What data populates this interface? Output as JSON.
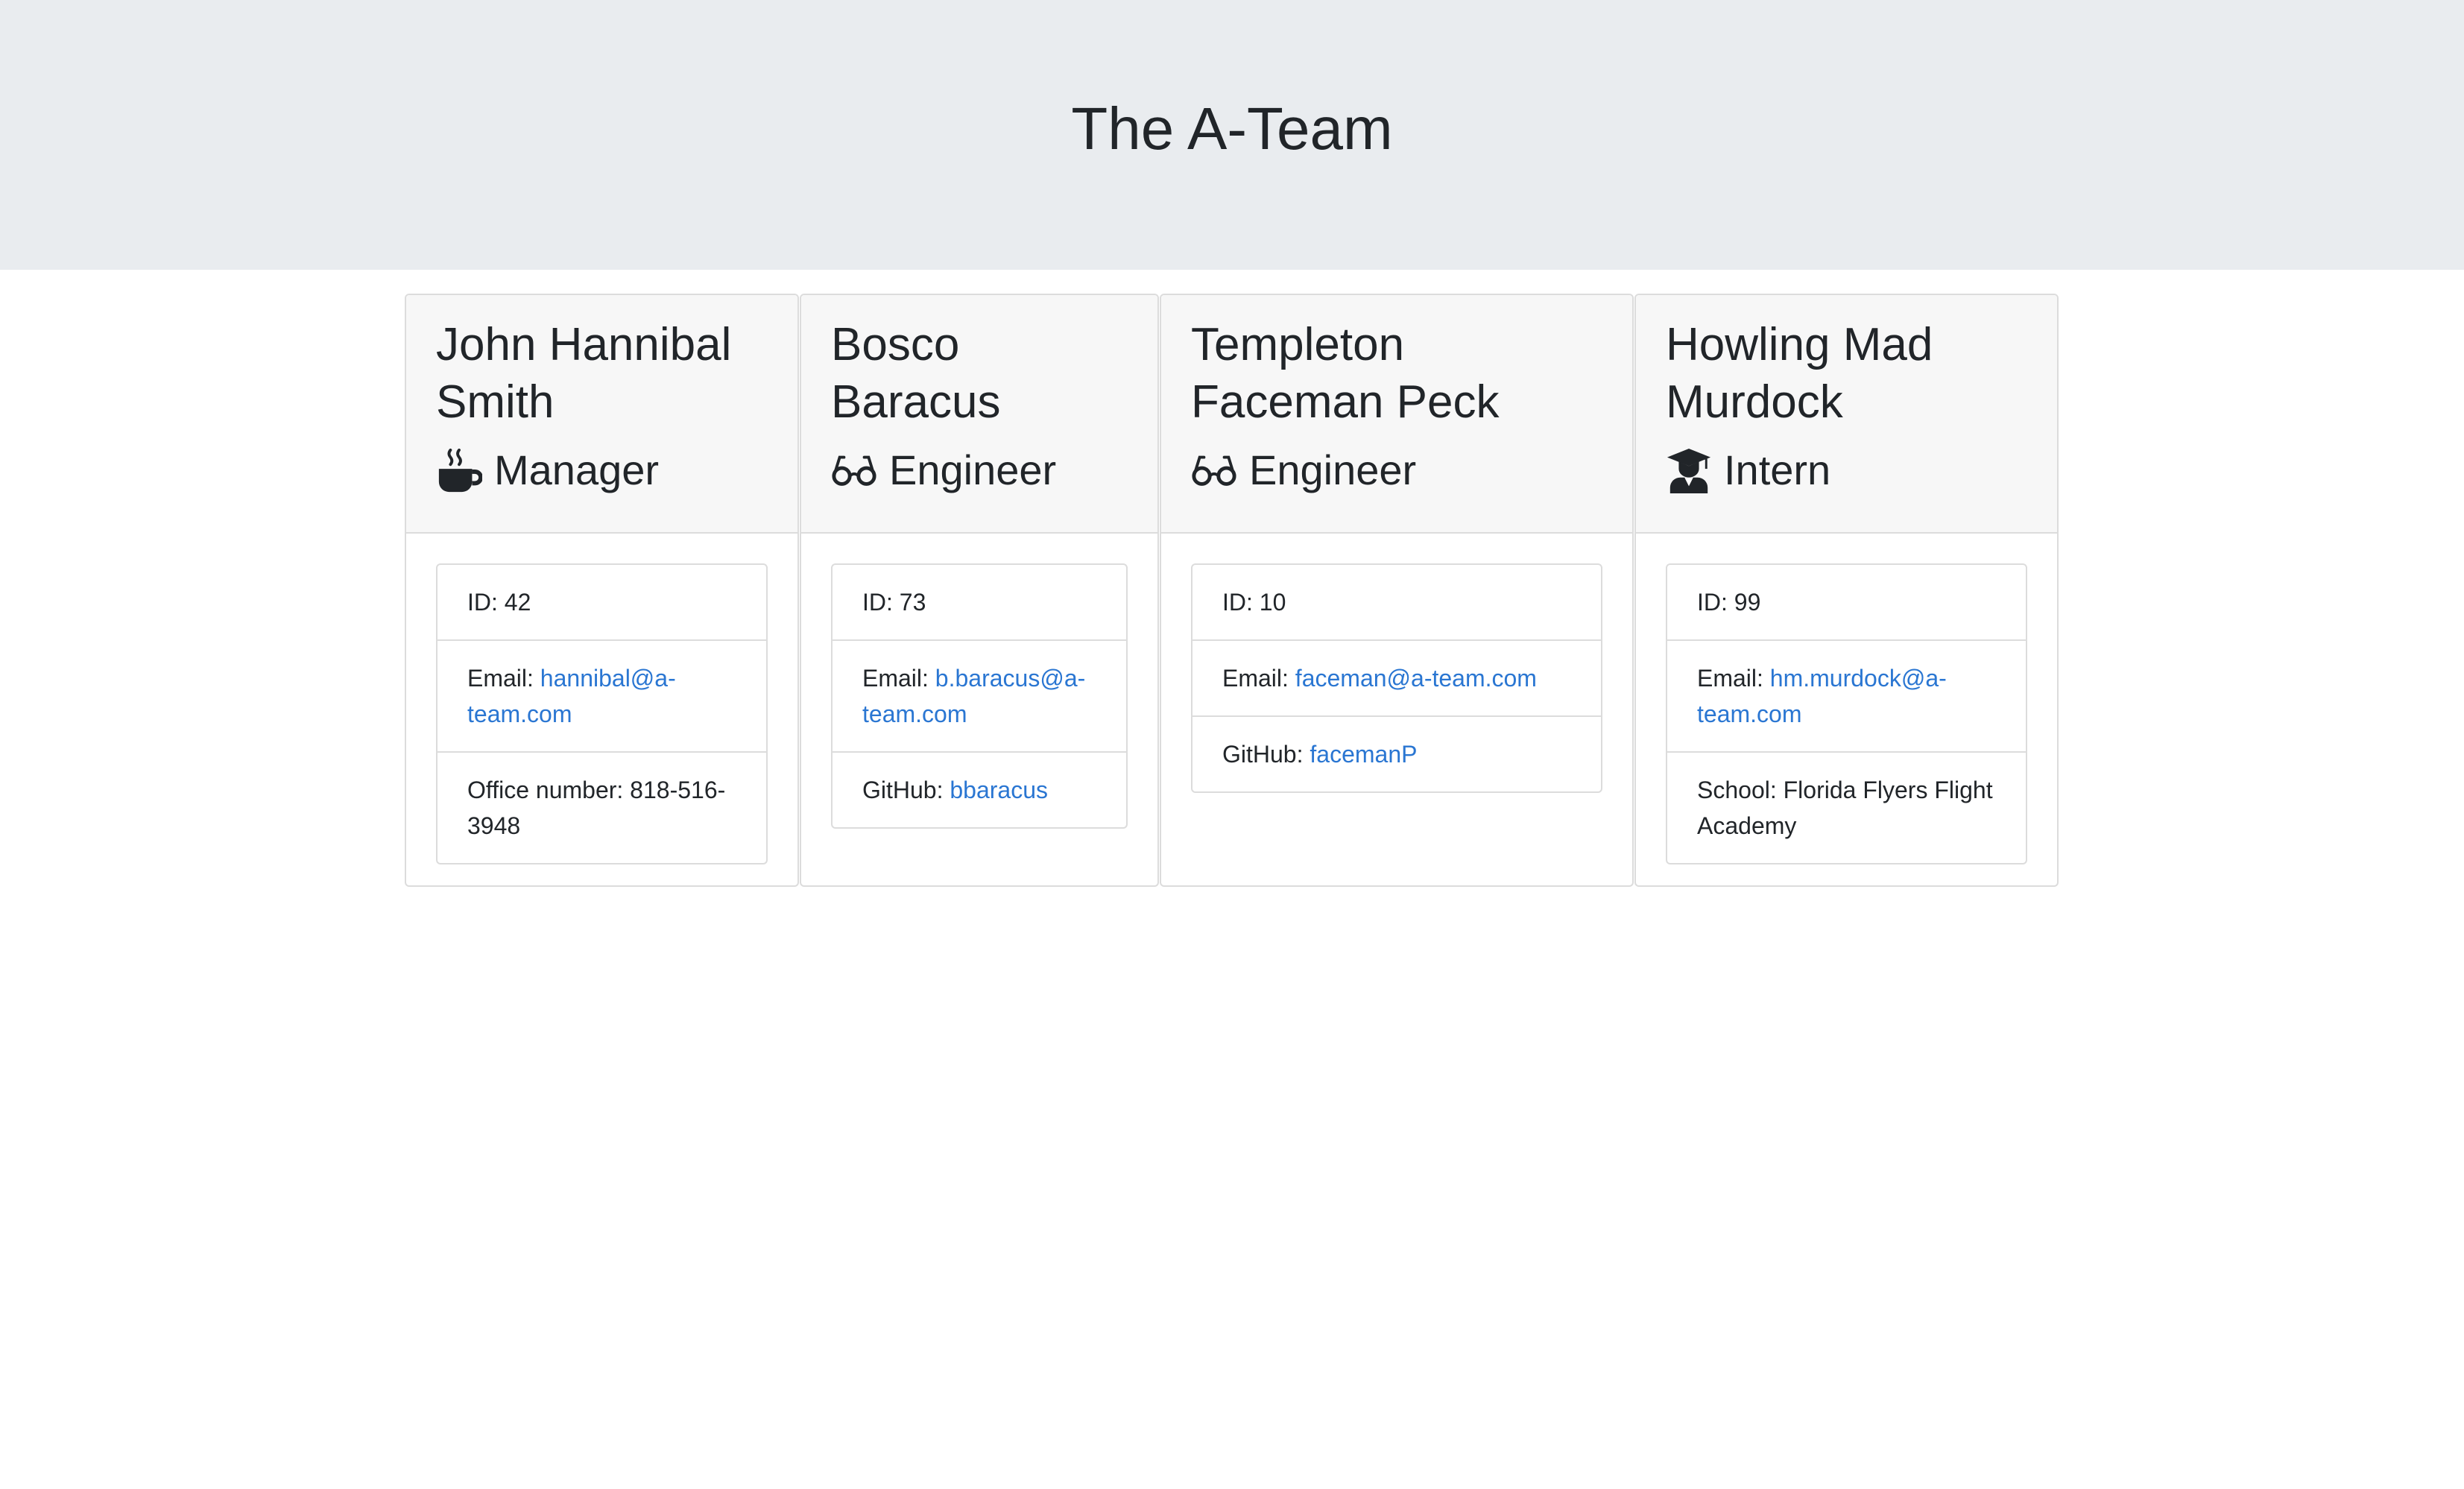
{
  "header": {
    "title": "The A-Team"
  },
  "colors": {
    "jumbotron_bg": "#e9ecef",
    "link": "#2a76d2",
    "card_header_bg": "#f7f7f7"
  },
  "team": [
    {
      "name_line1": "John Hannibal",
      "name_line2": "Smith",
      "role": "Manager",
      "role_icon": "coffee-mug-icon",
      "id_label": "ID: ",
      "id": "42",
      "email_label": "Email: ",
      "email_line1": "hannibal@a-",
      "email_line2": "team.com",
      "extra_label": "Office number: 818-516-",
      "extra_value": "3948"
    },
    {
      "name_line1": "Bosco",
      "name_line2": "Baracus",
      "role": "Engineer",
      "role_icon": "glasses-icon",
      "id_label": "ID: ",
      "id": "73",
      "email_label": "Email: ",
      "email_line1": "b.baracus@a-",
      "email_line2": "team.com",
      "extra_label": "GitHub: ",
      "extra_value": "bbaracus"
    },
    {
      "name_line1": "Templeton",
      "name_line2": "Faceman Peck",
      "role": "Engineer",
      "role_icon": "glasses-icon",
      "id_label": "ID: ",
      "id": "10",
      "email_label": "Email: ",
      "email_line1": "faceman@a-team.com",
      "email_line2": "",
      "extra_label": "GitHub: ",
      "extra_value": "facemanP"
    },
    {
      "name_line1": "Howling Mad",
      "name_line2": "Murdock",
      "role": "Intern",
      "role_icon": "graduate-icon",
      "id_label": "ID: ",
      "id": "99",
      "email_label": "Email: ",
      "email_line1": "hm.murdock@a-",
      "email_line2": "team.com",
      "extra_label": "School: Florida Flyers Flight",
      "extra_value": "Academy"
    }
  ]
}
